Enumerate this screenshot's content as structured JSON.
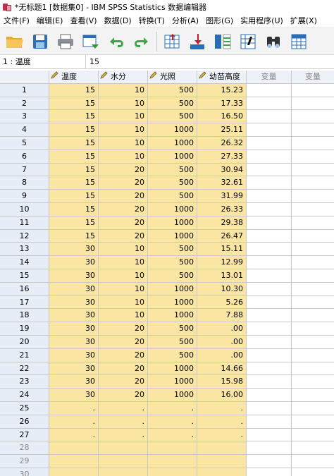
{
  "window": {
    "title": "*无标题1 [数据集0] - IBM SPSS Statistics 数据编辑器"
  },
  "menu": [
    "文件(F)",
    "编辑(E)",
    "查看(V)",
    "数据(D)",
    "转换(T)",
    "分析(A)",
    "图形(G)",
    "实用程序(U)",
    "扩展(X)"
  ],
  "cell_editor": {
    "reference": "1 : 温度",
    "value": "15"
  },
  "grid": {
    "columns": [
      "温度",
      "水分",
      "光照",
      "幼苗高度"
    ],
    "empty_columns": [
      "变量",
      "变量"
    ],
    "rows": [
      {
        "n": "1",
        "v": [
          "15",
          "10",
          "500",
          "15.23"
        ]
      },
      {
        "n": "2",
        "v": [
          "15",
          "10",
          "500",
          "17.33"
        ]
      },
      {
        "n": "3",
        "v": [
          "15",
          "10",
          "500",
          "16.50"
        ]
      },
      {
        "n": "4",
        "v": [
          "15",
          "10",
          "1000",
          "25.11"
        ]
      },
      {
        "n": "5",
        "v": [
          "15",
          "10",
          "1000",
          "26.32"
        ]
      },
      {
        "n": "6",
        "v": [
          "15",
          "10",
          "1000",
          "27.33"
        ]
      },
      {
        "n": "7",
        "v": [
          "15",
          "20",
          "500",
          "30.94"
        ]
      },
      {
        "n": "8",
        "v": [
          "15",
          "20",
          "500",
          "32.61"
        ]
      },
      {
        "n": "9",
        "v": [
          "15",
          "20",
          "500",
          "31.99"
        ]
      },
      {
        "n": "10",
        "v": [
          "15",
          "20",
          "1000",
          "26.33"
        ]
      },
      {
        "n": "11",
        "v": [
          "15",
          "20",
          "1000",
          "29.38"
        ]
      },
      {
        "n": "12",
        "v": [
          "15",
          "20",
          "1000",
          "26.47"
        ]
      },
      {
        "n": "13",
        "v": [
          "30",
          "10",
          "500",
          "15.11"
        ]
      },
      {
        "n": "14",
        "v": [
          "30",
          "10",
          "500",
          "12.99"
        ]
      },
      {
        "n": "15",
        "v": [
          "30",
          "10",
          "500",
          "13.01"
        ]
      },
      {
        "n": "16",
        "v": [
          "30",
          "10",
          "1000",
          "10.30"
        ]
      },
      {
        "n": "17",
        "v": [
          "30",
          "10",
          "1000",
          "5.26"
        ]
      },
      {
        "n": "18",
        "v": [
          "30",
          "10",
          "1000",
          "7.88"
        ]
      },
      {
        "n": "19",
        "v": [
          "30",
          "20",
          "500",
          ".00"
        ]
      },
      {
        "n": "20",
        "v": [
          "30",
          "20",
          "500",
          ".00"
        ]
      },
      {
        "n": "21",
        "v": [
          "30",
          "20",
          "500",
          ".00"
        ]
      },
      {
        "n": "22",
        "v": [
          "30",
          "20",
          "1000",
          "14.66"
        ]
      },
      {
        "n": "23",
        "v": [
          "30",
          "20",
          "1000",
          "15.98"
        ]
      },
      {
        "n": "24",
        "v": [
          "30",
          "20",
          "1000",
          "16.00"
        ]
      },
      {
        "n": "25",
        "v": [
          ".",
          ".",
          ".",
          "."
        ]
      },
      {
        "n": "26",
        "v": [
          ".",
          ".",
          ".",
          "."
        ]
      },
      {
        "n": "27",
        "v": [
          ".",
          ".",
          ".",
          "."
        ]
      },
      {
        "n": "28",
        "v": [
          "",
          "",
          "",
          ""
        ],
        "dim": true
      },
      {
        "n": "29",
        "v": [
          "",
          "",
          "",
          ""
        ],
        "dim": true
      },
      {
        "n": "30",
        "v": [
          "",
          "",
          "",
          ""
        ],
        "dim": true
      }
    ]
  },
  "colors": {
    "data_cell": "#fae5a3",
    "row_header": "#e7edf6",
    "grid_line": "#c8c8c8"
  },
  "toolbar_icons": [
    "open-folder-icon",
    "save-icon",
    "print-icon",
    "dialog-recall-icon",
    "undo-icon",
    "redo-icon",
    "goto-case-icon",
    "goto-variable-icon",
    "variables-icon",
    "value-labels-icon",
    "find-icon",
    "split-file-icon"
  ]
}
